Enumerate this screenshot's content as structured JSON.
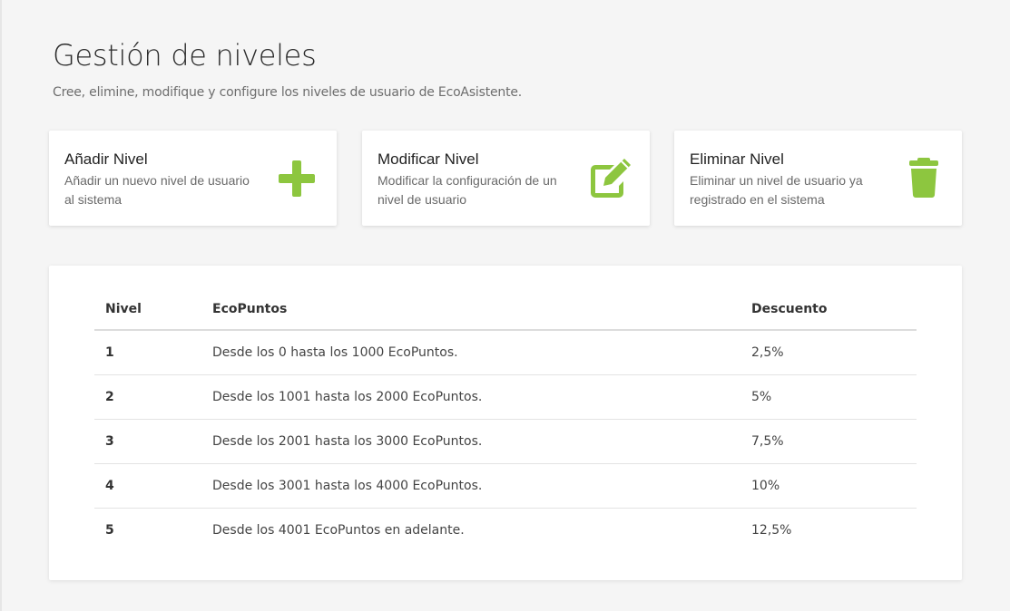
{
  "page": {
    "title": "Gestión de niveles",
    "subtitle": "Cree, elimine, modifique y configure los niveles de usuario de EcoAsistente."
  },
  "colors": {
    "accent": "#8dc63f"
  },
  "cards": [
    {
      "title": "Añadir Nivel",
      "description": "Añadir un nuevo nivel de usuario al sistema",
      "icon": "plus-icon"
    },
    {
      "title": "Modificar Nivel",
      "description": "Modificar la configuración de un nivel de usuario",
      "icon": "edit-icon"
    },
    {
      "title": "Eliminar Nivel",
      "description": "Eliminar un nivel de usuario ya registrado en el sistema",
      "icon": "trash-icon"
    }
  ],
  "table": {
    "headers": [
      "Nivel",
      "EcoPuntos",
      "Descuento"
    ],
    "rows": [
      {
        "nivel": "1",
        "ecopuntos": "Desde los 0 hasta los 1000 EcoPuntos.",
        "descuento": "2,5%"
      },
      {
        "nivel": "2",
        "ecopuntos": "Desde los 1001 hasta los 2000 EcoPuntos.",
        "descuento": "5%"
      },
      {
        "nivel": "3",
        "ecopuntos": "Desde los 2001 hasta los 3000 EcoPuntos.",
        "descuento": "7,5%"
      },
      {
        "nivel": "4",
        "ecopuntos": "Desde los 3001 hasta los 4000 EcoPuntos.",
        "descuento": "10%"
      },
      {
        "nivel": "5",
        "ecopuntos": "Desde los 4001 EcoPuntos en adelante.",
        "descuento": "12,5%"
      }
    ]
  }
}
